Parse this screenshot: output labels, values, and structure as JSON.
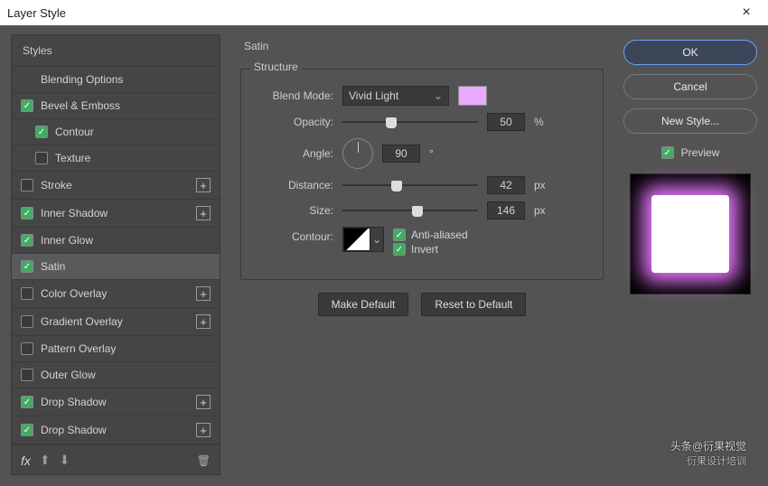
{
  "window": {
    "title": "Layer Style"
  },
  "sidebar": {
    "header": "Styles",
    "items": [
      {
        "label": "Blending Options",
        "checked": null,
        "plus": false,
        "sub": false
      },
      {
        "label": "Bevel & Emboss",
        "checked": true,
        "plus": false,
        "sub": false
      },
      {
        "label": "Contour",
        "checked": true,
        "plus": false,
        "sub": true
      },
      {
        "label": "Texture",
        "checked": false,
        "plus": false,
        "sub": true
      },
      {
        "label": "Stroke",
        "checked": false,
        "plus": true,
        "sub": false
      },
      {
        "label": "Inner Shadow",
        "checked": true,
        "plus": true,
        "sub": false
      },
      {
        "label": "Inner Glow",
        "checked": true,
        "plus": false,
        "sub": false
      },
      {
        "label": "Satin",
        "checked": true,
        "plus": false,
        "sub": false,
        "selected": true
      },
      {
        "label": "Color Overlay",
        "checked": false,
        "plus": true,
        "sub": false
      },
      {
        "label": "Gradient Overlay",
        "checked": false,
        "plus": true,
        "sub": false
      },
      {
        "label": "Pattern Overlay",
        "checked": false,
        "plus": false,
        "sub": false
      },
      {
        "label": "Outer Glow",
        "checked": false,
        "plus": false,
        "sub": false
      },
      {
        "label": "Drop Shadow",
        "checked": true,
        "plus": true,
        "sub": false
      },
      {
        "label": "Drop Shadow",
        "checked": true,
        "plus": true,
        "sub": false
      }
    ],
    "footer": {
      "fx": "fx"
    }
  },
  "panel": {
    "title": "Satin",
    "group_title": "Structure",
    "blend_mode_label": "Blend Mode:",
    "blend_mode_value": "Vivid Light",
    "swatch_color": "#e9a9ff",
    "opacity_label": "Opacity:",
    "opacity_value": "50",
    "opacity_unit": "%",
    "opacity_thumb_pct": 36,
    "angle_label": "Angle:",
    "angle_value": "90",
    "angle_unit": "°",
    "distance_label": "Distance:",
    "distance_value": "42",
    "distance_unit": "px",
    "distance_thumb_pct": 40,
    "size_label": "Size:",
    "size_value": "146",
    "size_unit": "px",
    "size_thumb_pct": 55,
    "contour_label": "Contour:",
    "anti_aliased_label": "Anti-aliased",
    "anti_aliased_checked": true,
    "invert_label": "Invert",
    "invert_checked": true,
    "make_default": "Make Default",
    "reset_default": "Reset to Default"
  },
  "right": {
    "ok": "OK",
    "cancel": "Cancel",
    "new_style": "New Style...",
    "preview_label": "Preview",
    "preview_checked": true
  },
  "watermark": {
    "line1": "头条@衍果视觉",
    "line2": "衍果设计培训"
  }
}
